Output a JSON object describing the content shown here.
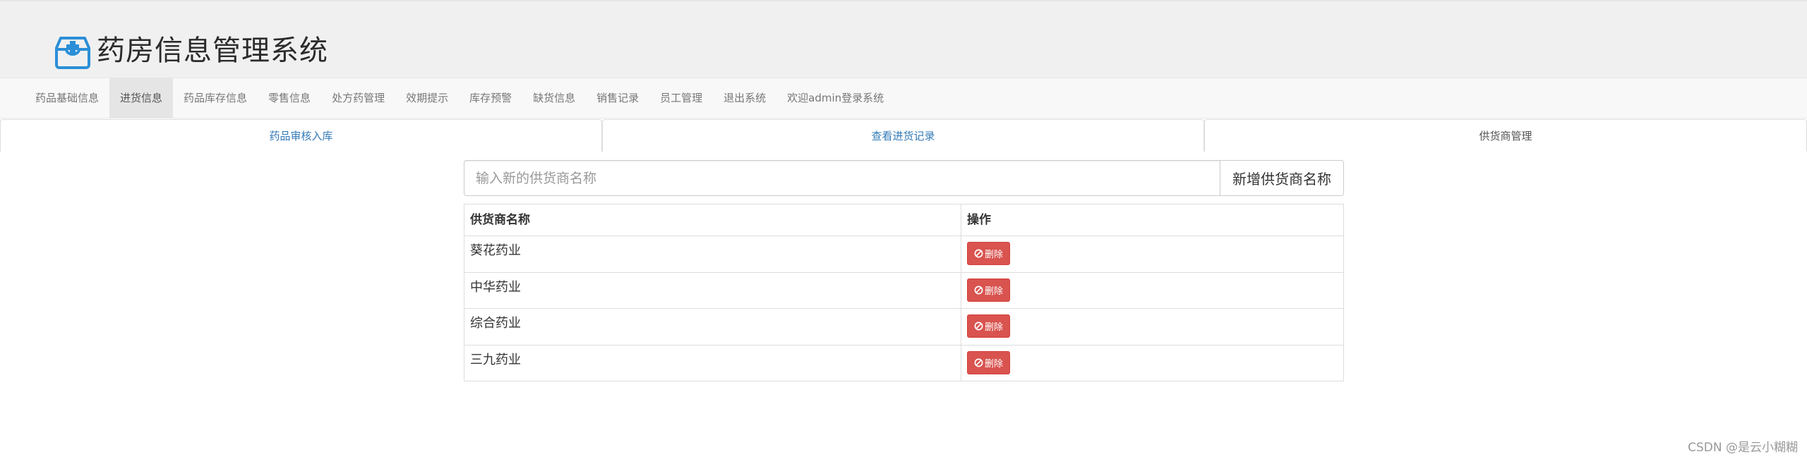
{
  "app": {
    "title": "药房信息管理系统",
    "logo_icon": "medical-kit-icon",
    "brand_color": "#2b8fd8"
  },
  "nav": {
    "items": [
      {
        "label": "药品基础信息",
        "active": false
      },
      {
        "label": "进货信息",
        "active": true
      },
      {
        "label": "药品库存信息",
        "active": false
      },
      {
        "label": "零售信息",
        "active": false
      },
      {
        "label": "处方药管理",
        "active": false
      },
      {
        "label": "效期提示",
        "active": false
      },
      {
        "label": "库存预警",
        "active": false
      },
      {
        "label": "缺货信息",
        "active": false
      },
      {
        "label": "销售记录",
        "active": false
      },
      {
        "label": "员工管理",
        "active": false
      },
      {
        "label": "退出系统",
        "active": false
      },
      {
        "label": "欢迎admin登录系统",
        "active": false
      }
    ]
  },
  "tabs": [
    {
      "label": "药品审核入库",
      "active": false
    },
    {
      "label": "查看进货记录",
      "active": false
    },
    {
      "label": "供货商管理",
      "active": true
    }
  ],
  "supplier_form": {
    "placeholder": "输入新的供货商名称",
    "value": "",
    "add_button_label": "新增供货商名称"
  },
  "table": {
    "headers": {
      "name": "供货商名称",
      "action": "操作"
    },
    "rows": [
      {
        "name": "葵花药业",
        "delete_label": "删除"
      },
      {
        "name": "中华药业",
        "delete_label": "删除"
      },
      {
        "name": "综合药业",
        "delete_label": "删除"
      },
      {
        "name": "三九药业",
        "delete_label": "删除"
      }
    ],
    "delete_icon": "ban-icon",
    "delete_color": "#d9534f"
  },
  "watermark": "CSDN @是云小糊糊"
}
